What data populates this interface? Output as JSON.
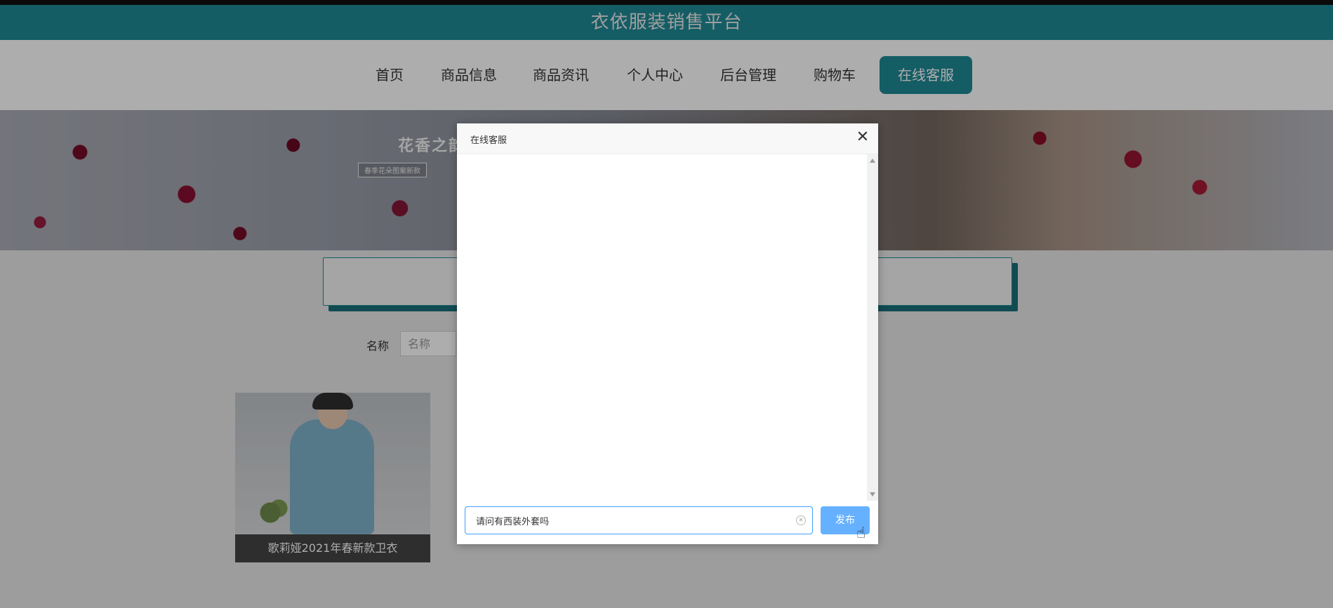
{
  "header": {
    "title": "衣依服装销售平台"
  },
  "nav": {
    "items": [
      {
        "label": "首页"
      },
      {
        "label": "商品信息"
      },
      {
        "label": "商品资讯"
      },
      {
        "label": "个人中心"
      },
      {
        "label": "后台管理"
      },
      {
        "label": "购物车"
      },
      {
        "label": "在线客服"
      }
    ],
    "active_index": 6
  },
  "banner": {
    "title": "花香之韵",
    "subtitle": "春季花朵图案新款"
  },
  "search": {
    "name_label": "名称",
    "name_placeholder": "名称"
  },
  "products": [
    {
      "title": "歌莉娅2021年春新款卫衣"
    }
  ],
  "dialog": {
    "title": "在线客服",
    "input_value": "请问有西装外套吗",
    "submit_label": "发布"
  },
  "colors": {
    "accent": "#1f8a96",
    "button": "#66b1ff",
    "input_border": "#409eff"
  }
}
